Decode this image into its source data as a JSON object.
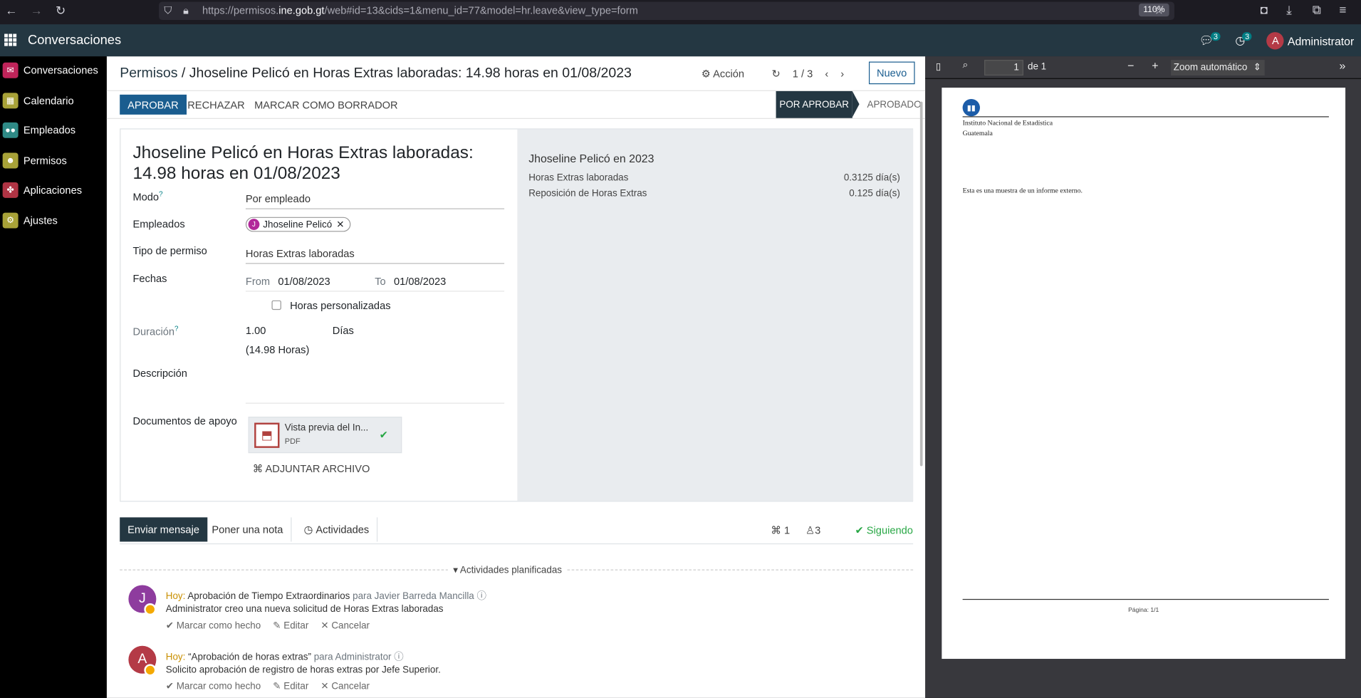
{
  "browser": {
    "url_prefix": "https://permisos.",
    "url_domain": "ine.gob.gt",
    "url_suffix": "/web#id=13&cids=1&menu_id=77&model=hr.leave&view_type=form",
    "zoom": "110%"
  },
  "navbar": {
    "brand": "Conversaciones",
    "messages_count": "3",
    "activities_count": "3",
    "user_initial": "A",
    "user_name": "Administrator"
  },
  "sidebar": {
    "items": [
      {
        "label": "Conversaciones",
        "color": "#c0245a"
      },
      {
        "label": "Calendario",
        "color": "#a8a238"
      },
      {
        "label": "Empleados",
        "color": "#2f8a86"
      },
      {
        "label": "Permisos",
        "color": "#a8a238"
      },
      {
        "label": "Aplicaciones",
        "color": "#b03444"
      },
      {
        "label": "Ajustes",
        "color": "#a8a238"
      }
    ]
  },
  "control_panel": {
    "crumb_parent": "Permisos",
    "crumb_sep": "/",
    "crumb_current": "Jhoseline Pelicó en Horas Extras laboradas: 14.98 horas en 01/08/2023",
    "action_label": "Acción",
    "pager": "1 / 3",
    "new_label": "Nuevo"
  },
  "statusbar": {
    "approve": "APROBAR",
    "reject": "RECHAZAR",
    "draft": "MARCAR COMO BORRADOR",
    "stage_current": "POR APROBAR",
    "stage_next": "APROBADO"
  },
  "form": {
    "title": "Jhoseline Pelicó en Horas Extras laboradas: 14.98 horas en 01/08/2023",
    "mode_label": "Modo",
    "mode_help": "?",
    "mode_value": "Por empleado",
    "employees_label": "Empleados",
    "employee_initial": "J",
    "employee_tag": "Jhoseline Pelicó",
    "leave_type_label": "Tipo de permiso",
    "leave_type_value": "Horas Extras laboradas",
    "dates_label": "Fechas",
    "from_label": "From",
    "from_value": "01/08/2023",
    "to_label": "To",
    "to_value": "01/08/2023",
    "custom_hours_label": "Horas personalizadas",
    "duration_label": "Duración",
    "duration_help": "?",
    "duration_value": "1.00",
    "duration_unit": "Días",
    "duration_hours": "(14.98 Horas)",
    "description_label": "Descripción",
    "docs_label": "Documentos de apoyo",
    "attachment_name": "Vista previa del In...",
    "attachment_ext": "PDF",
    "attach_label": "ADJUNTAR ARCHIVO"
  },
  "summary": {
    "title": "Jhoseline Pelicó en 2023",
    "rows": [
      {
        "label": "Horas Extras laboradas",
        "value": "0.3125 día(s)"
      },
      {
        "label": "Reposición de Horas Extras",
        "value": "0.125 día(s)"
      }
    ]
  },
  "chatter": {
    "send_message": "Enviar mensaje",
    "log_note": "Poner una nota",
    "activities": "Actividades",
    "attachments_count": "1",
    "followers_count": "3",
    "following": "Siguiendo",
    "planned_title": "Actividades planificadas",
    "activities_list": [
      {
        "initial": "J",
        "avatar_color": "#8e3c9e",
        "when": "Hoy:",
        "summary": "Aprobación de Tiempo Extraordinarios",
        "for": "para Javier Barreda Mancilla",
        "note": "Administrator creo una nueva solicitud de Horas Extras laboradas",
        "mark_done": "Marcar como hecho",
        "edit": "Editar",
        "cancel": "Cancelar"
      },
      {
        "initial": "A",
        "avatar_color": "#b43a46",
        "when": "Hoy:",
        "summary": "“Aprobación de horas extras”",
        "for": "para Administrator",
        "note": "Solicito aprobación de registro de horas extras por Jefe Superior.",
        "mark_done": "Marcar como hecho",
        "edit": "Editar",
        "cancel": "Cancelar"
      }
    ]
  },
  "pdf": {
    "page_number": "1",
    "page_total": "de 1",
    "zoom": "Zoom automático",
    "org_line1": "Instituto Nacional de Estadística",
    "org_line2": "Guatemala",
    "body": "Esta es una muestra de un informe externo.",
    "footer": "Página: 1/1"
  }
}
